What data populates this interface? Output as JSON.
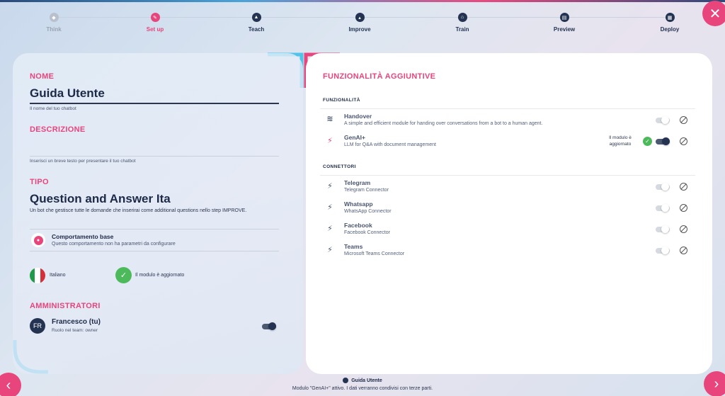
{
  "stepper": {
    "steps": [
      {
        "label": "Think",
        "state": "done"
      },
      {
        "label": "Set up",
        "state": "active"
      },
      {
        "label": "Teach",
        "state": "todo"
      },
      {
        "label": "Improve",
        "state": "todo"
      },
      {
        "label": "Train",
        "state": "todo"
      },
      {
        "label": "Preview",
        "state": "todo"
      },
      {
        "label": "Deploy",
        "state": "todo"
      }
    ]
  },
  "left": {
    "nome_title": "NOME",
    "nome_value": "Guida Utente",
    "nome_hint": "Il nome del tuo chatbot",
    "descr_title": "DESCRIZIONE",
    "descr_value": "",
    "descr_hint": "Inserisci un breve testo per presentare il tuo chatbot",
    "tipo_title": "TIPO",
    "tipo_value": "Question and Answer Ita",
    "tipo_desc": "Un bot che gestisce tutte le domande che inserirai come additional questions nello step IMPROVE.",
    "behavior_title": "Comportamento base",
    "behavior_desc": "Questo comportamento non ha parametri da configurare",
    "language": "Italiano",
    "module_status": "Il modulo è aggiornato",
    "admin_title": "AMMINISTRATORI",
    "admin_initials": "FR",
    "admin_name": "Francesco (tu)",
    "admin_role": "Ruolo nel team: owner"
  },
  "right": {
    "title": "FUNZIONALITÀ AGGIUNTIVE",
    "features_title": "FUNZIONALITÀ",
    "connectors_title": "CONNETTORI",
    "features": [
      {
        "name": "Handover",
        "desc": "A simple and efficient module for handing over conversations from a bot to a human agent.",
        "icon": "handshake-icon",
        "enabled": false
      },
      {
        "name": "GenAI+",
        "desc": "LLM for Q&A with document management",
        "icon": "plug-icon",
        "enabled": true,
        "status": "Il modulo è aggiornato"
      }
    ],
    "connectors": [
      {
        "name": "Telegram",
        "desc": "Telegram Connector",
        "icon": "plug-icon",
        "enabled": false
      },
      {
        "name": "Whatsapp",
        "desc": "WhatsApp Connector",
        "icon": "plug-icon",
        "enabled": false
      },
      {
        "name": "Facebook",
        "desc": "Facebook Connector",
        "icon": "plug-icon",
        "enabled": false
      },
      {
        "name": "Teams",
        "desc": "Microsoft Teams Connector",
        "icon": "plug-icon",
        "enabled": false
      }
    ]
  },
  "footer": {
    "bot_name": "Guida Utente",
    "notice": "Modulo \"GenAI+\" attivo. I dati verranno condivisi con terze parti."
  },
  "colors": {
    "accent": "#e8457c",
    "navy": "#243352",
    "cyan": "#4fc3e8"
  }
}
